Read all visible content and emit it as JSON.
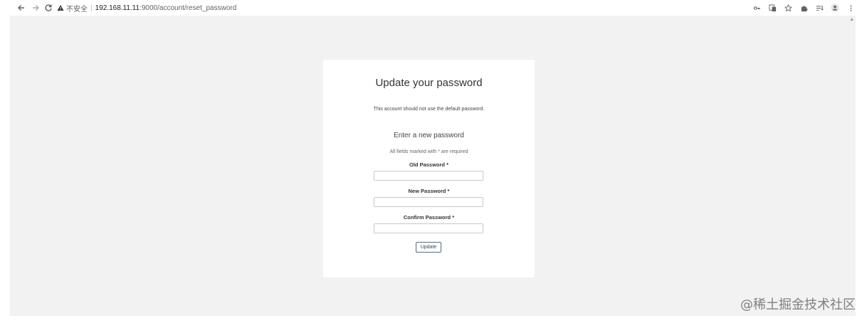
{
  "browser": {
    "security_label": "不安全",
    "url_host": "192.168.11.11",
    "url_path": ":9000/account/reset_password"
  },
  "icons": {
    "back": "arrow-left",
    "forward": "arrow-right",
    "reload": "reload",
    "warning": "warning-triangle",
    "key": "key",
    "translate": "translate",
    "bookmark": "star",
    "extensions": "puzzle",
    "reading_list": "reading-list",
    "profile": "person",
    "menu": "kebab-menu"
  },
  "card": {
    "title": "Update your password",
    "notice": "This account should not use the default password.",
    "subtitle": "Enter a new password",
    "required_note": "All fields marked with * are required",
    "fields": [
      {
        "label": "Old Password *",
        "value": ""
      },
      {
        "label": "New Password *",
        "value": ""
      },
      {
        "label": "Confirm Password *",
        "value": ""
      }
    ],
    "submit_label": "Update"
  },
  "watermark": "@稀土掘金技术社区"
}
